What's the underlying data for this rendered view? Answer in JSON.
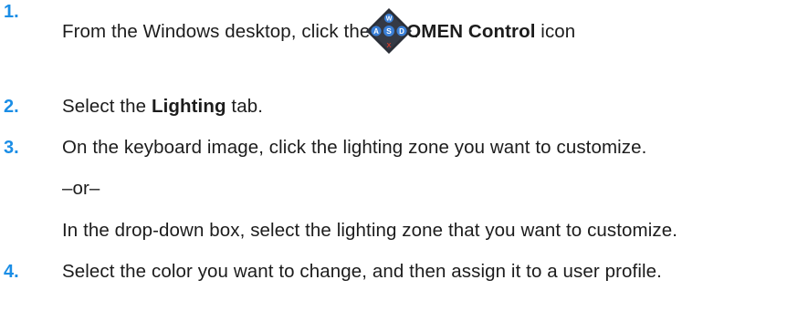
{
  "steps": [
    {
      "number": "1.",
      "pre": "From the Windows desktop, click the ",
      "bold": "HP OMEN Control",
      "post": " icon",
      "tail": ".",
      "icon": "hp-omen-control-icon"
    },
    {
      "number": "2.",
      "pre": "Select the ",
      "bold": "Lighting",
      "post": " tab."
    },
    {
      "number": "3.",
      "text": "On the keyboard image, click the lighting zone you want to customize.",
      "or": "–or–",
      "alt": "In the drop-down box, select the lighting zone that you want to customize."
    },
    {
      "number": "4.",
      "text": "Select the color you want to change, and then assign it to a user profile."
    }
  ],
  "icon_keys": [
    "W",
    "A",
    "S",
    "D",
    "X"
  ],
  "colors": {
    "step_number": "#1b8ee6",
    "icon_body": "#2b2f38",
    "icon_keys": "#3a7fd6",
    "icon_x": "#d13a2a"
  }
}
